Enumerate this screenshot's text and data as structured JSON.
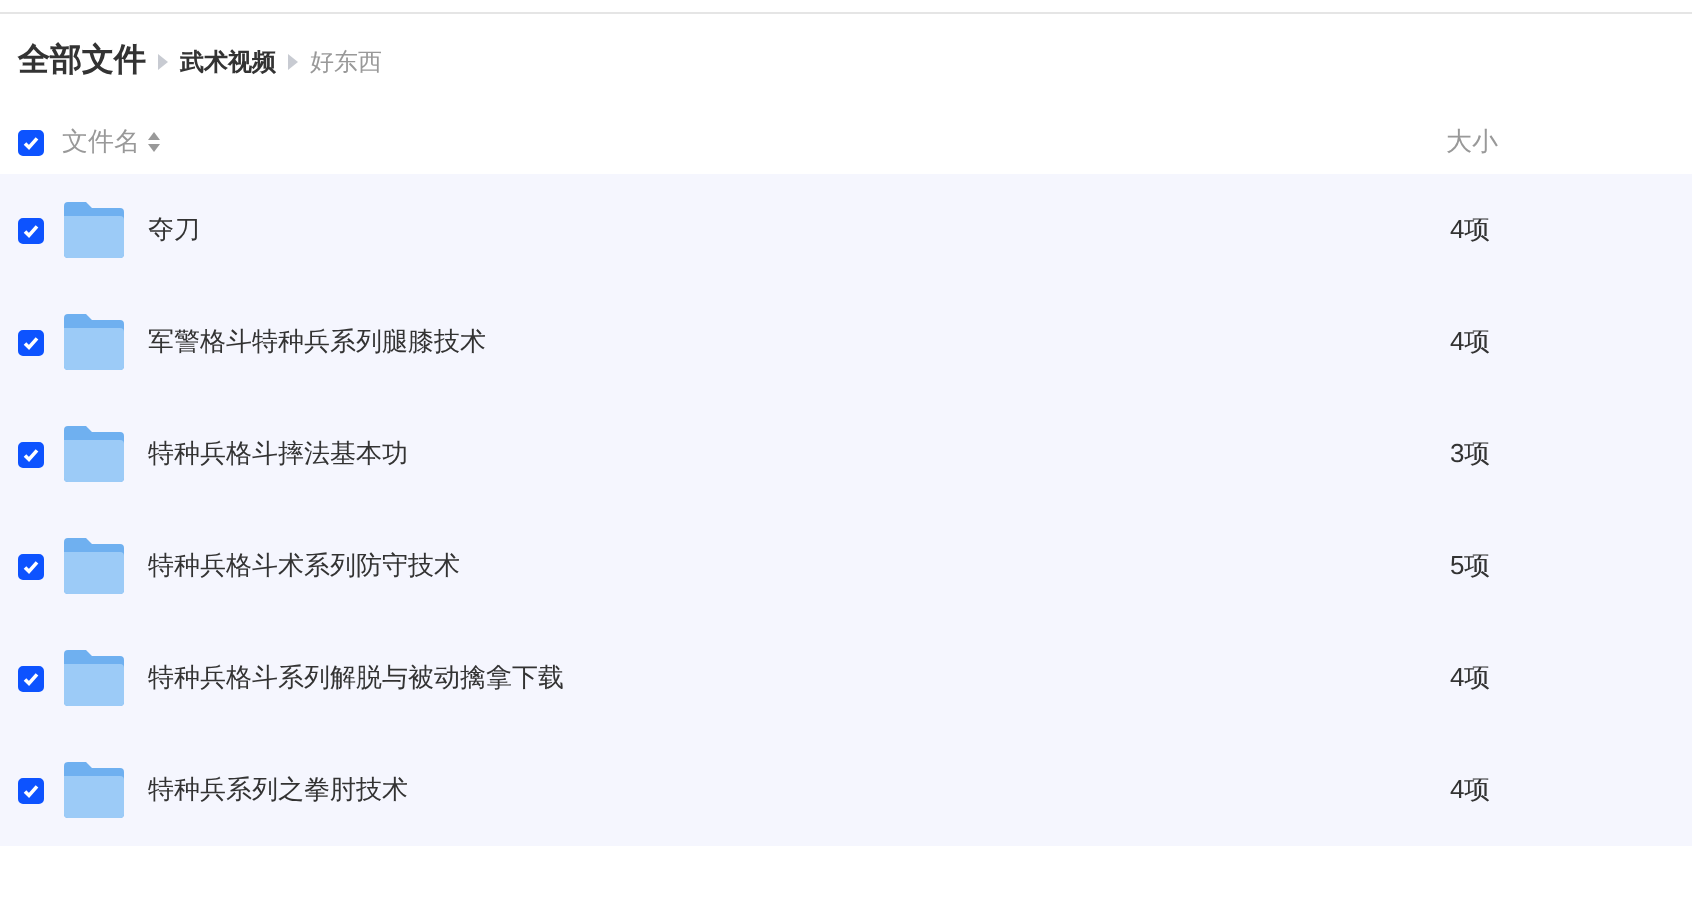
{
  "breadcrumb": [
    {
      "label": "全部文件",
      "kind": "root"
    },
    {
      "label": "武术视频",
      "kind": "folder"
    },
    {
      "label": "好东西",
      "kind": "current"
    }
  ],
  "header": {
    "checked": true,
    "columns": [
      "文件名",
      "大小"
    ]
  },
  "rows": [
    {
      "name": "夺刀",
      "size": "4项",
      "checked": true
    },
    {
      "name": "军警格斗特种兵系列腿膝技术",
      "size": "4项",
      "checked": true
    },
    {
      "name": "特种兵格斗摔法基本功",
      "size": "3项",
      "checked": true
    },
    {
      "name": "特种兵格斗术系列防守技术",
      "size": "5项",
      "checked": true
    },
    {
      "name": "特种兵格斗系列解脱与被动擒拿下载",
      "size": "4项",
      "checked": true
    },
    {
      "name": "特种兵系列之拳肘技术",
      "size": "4项",
      "checked": true
    }
  ]
}
